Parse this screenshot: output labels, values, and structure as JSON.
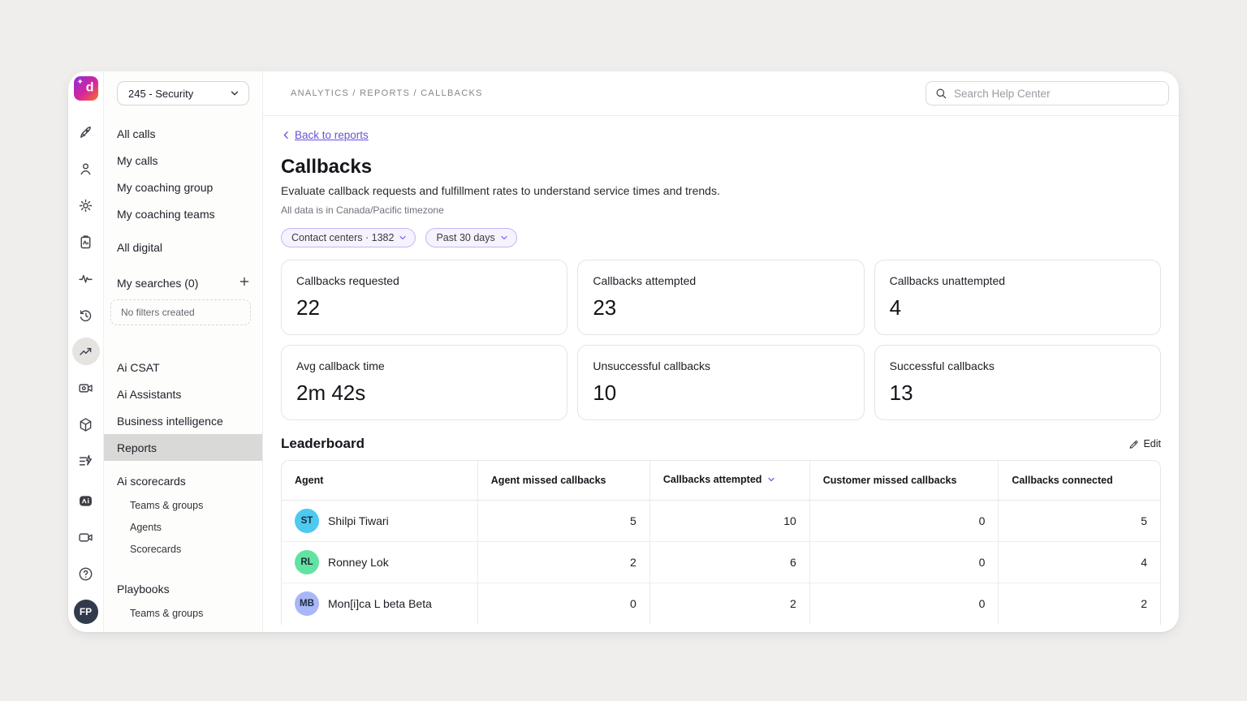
{
  "brand": {
    "logo_letter": "d",
    "sparkle": "✦"
  },
  "workspace_selector": {
    "label": "245 - Security"
  },
  "rail": {
    "top": [
      {
        "name": "rocket-icon"
      },
      {
        "name": "person-icon"
      },
      {
        "name": "gear-icon"
      },
      {
        "name": "clipboard-ai-icon"
      },
      {
        "name": "pulse-icon"
      },
      {
        "name": "history-icon"
      },
      {
        "name": "trending-up-icon",
        "selected": true
      },
      {
        "name": "camera-gear-icon",
        "gap": true
      },
      {
        "name": "cube-icon"
      },
      {
        "name": "list-lightning-icon"
      }
    ],
    "bottom": [
      {
        "name": "ai-app-icon"
      },
      {
        "name": "video-camera-icon"
      },
      {
        "name": "help-icon"
      }
    ],
    "avatar_initials": "FP"
  },
  "sidebar": {
    "items": [
      {
        "label": "All calls",
        "kind": "item"
      },
      {
        "label": "My calls",
        "kind": "item"
      },
      {
        "label": "My coaching group",
        "kind": "item"
      },
      {
        "label": "My coaching teams",
        "kind": "item"
      },
      {
        "label": "All digital",
        "kind": "item",
        "gap": "sm"
      },
      {
        "label": "My searches (0)",
        "kind": "searches",
        "gap": "md"
      },
      {
        "label": "No filters created",
        "kind": "note"
      },
      {
        "label": "Ai CSAT",
        "kind": "item",
        "gap": "lg"
      },
      {
        "label": "Ai Assistants",
        "kind": "item"
      },
      {
        "label": "Business intelligence",
        "kind": "item"
      },
      {
        "label": "Reports",
        "kind": "item",
        "selected": true
      },
      {
        "label": "Ai scorecards",
        "kind": "item",
        "gap": "sm"
      },
      {
        "label": "Teams & groups",
        "kind": "sub"
      },
      {
        "label": "Agents",
        "kind": "sub"
      },
      {
        "label": "Scorecards",
        "kind": "sub"
      },
      {
        "label": "Playbooks",
        "kind": "item",
        "gap": "xl"
      },
      {
        "label": "Teams & groups",
        "kind": "sub"
      }
    ]
  },
  "topbar": {
    "breadcrumb": "ANALYTICS / REPORTS / CALLBACKS",
    "search_placeholder": "Search Help Center"
  },
  "page": {
    "back_label": "Back to reports",
    "title": "Callbacks",
    "subtitle": "Evaluate callback requests and fulfillment rates to understand service times and trends.",
    "timezone_note": "All data is in Canada/Pacific timezone",
    "filters": [
      {
        "label": "Contact centers · 1382"
      },
      {
        "label": "Past 30 days"
      }
    ],
    "stats": [
      {
        "label": "Callbacks requested",
        "value": "22"
      },
      {
        "label": "Callbacks attempted",
        "value": "23"
      },
      {
        "label": "Callbacks unattempted",
        "value": "4"
      },
      {
        "label": "Avg callback time",
        "value": "2m 42s"
      },
      {
        "label": "Unsuccessful callbacks",
        "value": "10"
      },
      {
        "label": "Successful callbacks",
        "value": "13"
      }
    ],
    "leaderboard": {
      "title": "Leaderboard",
      "edit_label": "Edit",
      "columns": [
        {
          "label": "Agent",
          "sorted": false
        },
        {
          "label": "Agent missed callbacks",
          "sorted": false
        },
        {
          "label": "Callbacks attempted",
          "sorted": true
        },
        {
          "label": "Customer missed callbacks",
          "sorted": false
        },
        {
          "label": "Callbacks connected",
          "sorted": false
        }
      ],
      "rows": [
        {
          "initials": "ST",
          "name": "Shilpi Tiwari",
          "avatar_color": "#4ec9ef",
          "values": [
            "5",
            "10",
            "0",
            "5"
          ]
        },
        {
          "initials": "RL",
          "name": "Ronney Lok",
          "avatar_color": "#62e3a1",
          "values": [
            "2",
            "6",
            "0",
            "4"
          ]
        },
        {
          "initials": "MB",
          "name": "Mon[i]ca L beta Beta",
          "avatar_color": "#a9b6f8",
          "values": [
            "0",
            "2",
            "0",
            "2"
          ]
        }
      ]
    }
  },
  "colors": {
    "accent_purple": "#6753d8",
    "pill_bg": "#f6f2fe",
    "pill_border": "#c6b5f7",
    "sidebar_selected_bg": "#d9d9d8",
    "user_avatar_bg": "#323b4b"
  }
}
